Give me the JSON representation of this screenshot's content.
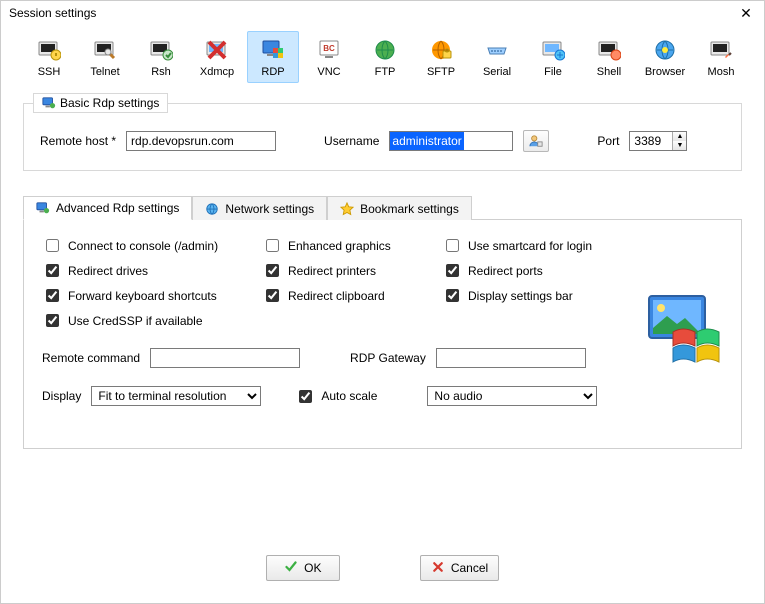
{
  "window": {
    "title": "Session settings"
  },
  "session_types": [
    {
      "key": "ssh",
      "label": "SSH",
      "selected": false
    },
    {
      "key": "telnet",
      "label": "Telnet",
      "selected": false
    },
    {
      "key": "rsh",
      "label": "Rsh",
      "selected": false
    },
    {
      "key": "xdmcp",
      "label": "Xdmcp",
      "selected": false
    },
    {
      "key": "rdp",
      "label": "RDP",
      "selected": true
    },
    {
      "key": "vnc",
      "label": "VNC",
      "selected": false
    },
    {
      "key": "ftp",
      "label": "FTP",
      "selected": false
    },
    {
      "key": "sftp",
      "label": "SFTP",
      "selected": false
    },
    {
      "key": "serial",
      "label": "Serial",
      "selected": false
    },
    {
      "key": "file",
      "label": "File",
      "selected": false
    },
    {
      "key": "shell",
      "label": "Shell",
      "selected": false
    },
    {
      "key": "browser",
      "label": "Browser",
      "selected": false
    },
    {
      "key": "mosh",
      "label": "Mosh",
      "selected": false
    }
  ],
  "basic": {
    "legend": "Basic Rdp settings",
    "remote_host_label": "Remote host *",
    "remote_host_value": "rdp.devopsrun.com",
    "username_label": "Username",
    "username_value": "administrator",
    "port_label": "Port",
    "port_value": "3389"
  },
  "tabs": {
    "advanced": "Advanced Rdp settings",
    "network": "Network settings",
    "bookmark": "Bookmark settings",
    "active": "advanced"
  },
  "advanced": {
    "checkboxes": [
      {
        "label": "Connect to console (/admin)",
        "checked": false
      },
      {
        "label": "Enhanced graphics",
        "checked": false
      },
      {
        "label": "Use smartcard for login",
        "checked": false
      },
      {
        "label": "Redirect drives",
        "checked": true
      },
      {
        "label": "Redirect printers",
        "checked": true
      },
      {
        "label": "Redirect ports",
        "checked": true
      },
      {
        "label": "Forward keyboard shortcuts",
        "checked": true
      },
      {
        "label": "Redirect clipboard",
        "checked": true
      },
      {
        "label": "Display settings bar",
        "checked": true
      },
      {
        "label": "Use CredSSP if available",
        "checked": true
      }
    ],
    "remote_command_label": "Remote command",
    "remote_command_value": "",
    "rdp_gateway_label": "RDP Gateway",
    "rdp_gateway_value": "",
    "display_label": "Display",
    "display_value": "Fit to terminal resolution",
    "auto_scale_label": "Auto scale",
    "auto_scale_checked": true,
    "audio_value": "No audio"
  },
  "buttons": {
    "ok": "OK",
    "cancel": "Cancel"
  }
}
